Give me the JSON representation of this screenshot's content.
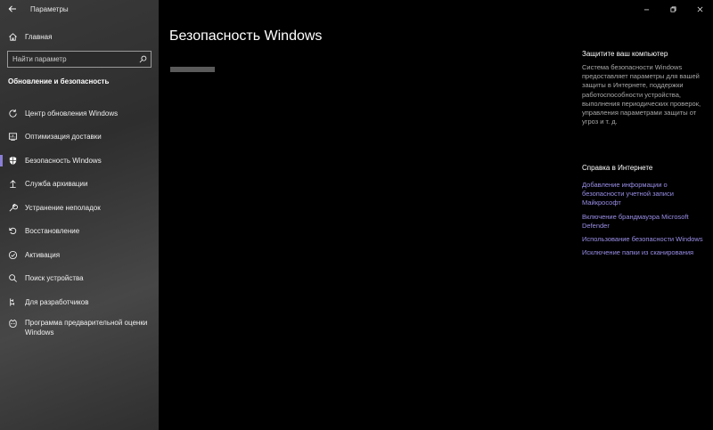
{
  "window": {
    "title": "Параметры",
    "controls": [
      "minimize-icon",
      "restore-icon",
      "close-icon"
    ]
  },
  "sidebar": {
    "home_label": "Главная",
    "search_placeholder": "Найти параметр",
    "section_title": "Обновление и безопасность",
    "items": [
      {
        "label": "Центр обновления Windows",
        "icon": "refresh-icon"
      },
      {
        "label": "Оптимизация доставки",
        "icon": "delivery-icon"
      },
      {
        "label": "Безопасность Windows",
        "icon": "shield-icon",
        "selected": true
      },
      {
        "label": "Служба архивации",
        "icon": "backup-icon"
      },
      {
        "label": "Устранение неполадок",
        "icon": "wrench-icon"
      },
      {
        "label": "Восстановление",
        "icon": "recovery-icon"
      },
      {
        "label": "Активация",
        "icon": "check-circle-icon"
      },
      {
        "label": "Поиск устройства",
        "icon": "locate-icon"
      },
      {
        "label": "Для разработчиков",
        "icon": "developer-icon"
      },
      {
        "label": "Программа предварительной оценки Windows",
        "icon": "insider-icon"
      }
    ]
  },
  "main": {
    "title": "Безопасность Windows"
  },
  "right_panel": {
    "protect_heading": "Защитите ваш компьютер",
    "protect_text": "Система безопасности Windows предоставляет параметры для вашей защиты в Интернете, поддержки работоспособности устройства, выполнения периодических проверок, управления параметрами защиты от угроз и т. д.",
    "help_heading": "Справка в Интернете",
    "links": [
      "Добавление информации о безопасности учетной записи Майкрософт",
      "Включение брандмауэра Microsoft Defender",
      "Использование безопасности Windows",
      "Исключение папки из сканирования"
    ]
  },
  "colors": {
    "accent": "#8a7fd6",
    "link": "#9a8fe8",
    "background": "#000000"
  }
}
